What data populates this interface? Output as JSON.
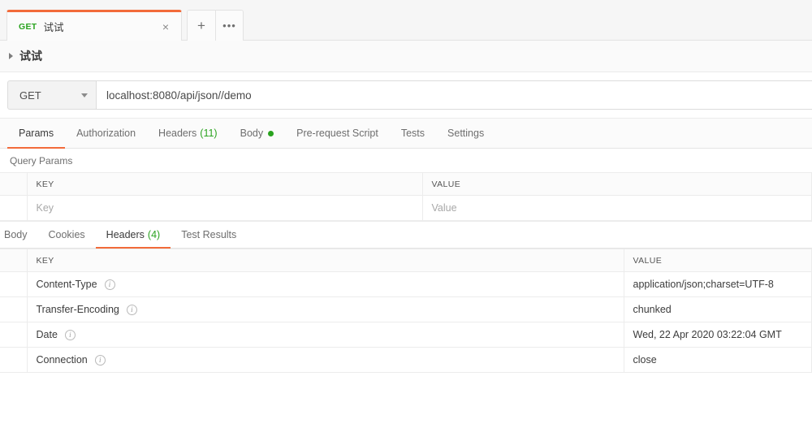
{
  "theme": {
    "accent": "#f26b3a",
    "green": "#2aa31f",
    "text": "#3a3a3a",
    "muted": "#6e6e6e",
    "border": "#ececec"
  },
  "tabbar": {
    "request_tab": {
      "method": "GET",
      "name": "试试",
      "close_icon": "×"
    },
    "new_tab_icon": "+",
    "more_icon": "•••"
  },
  "breadcrumb": {
    "label": "试试",
    "caret_icon": "caret-right-icon"
  },
  "url": {
    "method": "GET",
    "value": "localhost:8080/api/json//demo",
    "caret_icon": "caret-down-icon"
  },
  "request_tabs": [
    {
      "label": "Params",
      "active": true
    },
    {
      "label": "Authorization",
      "active": false
    },
    {
      "label": "Headers",
      "count": "(11)",
      "active": false
    },
    {
      "label": "Body",
      "dot": true,
      "active": false
    },
    {
      "label": "Pre-request Script",
      "active": false
    },
    {
      "label": "Tests",
      "active": false
    },
    {
      "label": "Settings",
      "active": false
    }
  ],
  "query_params": {
    "section_label": "Query Params",
    "columns": [
      "KEY",
      "VALUE"
    ],
    "rows": [
      {
        "key": "Key",
        "value": "Value",
        "placeholder": true
      }
    ]
  },
  "response_tabs": [
    {
      "label": "Body",
      "active": false
    },
    {
      "label": "Cookies",
      "active": false
    },
    {
      "label": "Headers",
      "count": "(4)",
      "active": true
    },
    {
      "label": "Test Results",
      "active": false
    }
  ],
  "response_headers": {
    "columns": [
      "KEY",
      "VALUE"
    ],
    "rows": [
      {
        "key": "Content-Type",
        "value": "application/json;charset=UTF-8"
      },
      {
        "key": "Transfer-Encoding",
        "value": "chunked"
      },
      {
        "key": "Date",
        "value": "Wed, 22 Apr 2020 03:22:04 GMT"
      },
      {
        "key": "Connection",
        "value": "close"
      }
    ]
  }
}
